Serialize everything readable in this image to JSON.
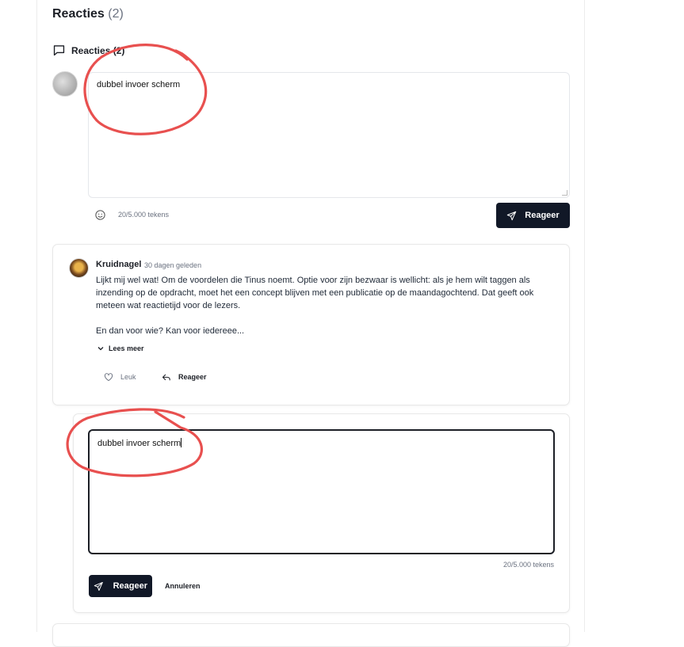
{
  "header": {
    "title": "Reacties",
    "count": "(2)"
  },
  "section": {
    "label": "Reacties (2)"
  },
  "composer": {
    "value": "dubbel invoer scherm",
    "counter": "20/5.000 tekens",
    "submit_label": "Reageer"
  },
  "comment": {
    "author": "Kruidnagel",
    "time": "30 dagen geleden",
    "paragraph1": "Lijkt mij wel wat! Om de voordelen die Tinus noemt. Optie voor zijn bezwaar is wellicht: als je hem wilt taggen als inzending op de opdracht, moet het een concept blijven met een publicatie op de maandagochtend. Dat geeft ook meteen wat reactietijd voor de lezers.",
    "paragraph2": "En dan voor wie? Kan voor iedereee...",
    "read_more": "Lees meer",
    "like_label": "Leuk",
    "reply_label": "Reageer"
  },
  "reply_composer": {
    "value": "dubbel invoer scherm",
    "counter": "20/5.000 tekens",
    "submit_label": "Reageer",
    "cancel_label": "Annuleren"
  },
  "colors": {
    "primary": "#111827",
    "annotation": "#e8504f",
    "muted": "#6b7280"
  },
  "icons": [
    "comment-icon",
    "emoji-icon",
    "send-icon",
    "heart-icon",
    "reply-arrow-icon",
    "chevron-down-icon"
  ]
}
